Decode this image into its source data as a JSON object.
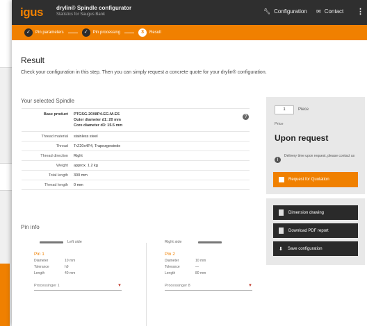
{
  "app": {
    "logo": "igus",
    "title": "drylin® Spindle configurator",
    "subtitle": "Statistics for Saugus Bank",
    "nav_config": "Configuration",
    "nav_contact": "Contact",
    "nav_more": "⋮"
  },
  "steps": [
    {
      "label": "Pin parameters",
      "state": "done"
    },
    {
      "label": "Pin processing",
      "state": "done"
    },
    {
      "label": "Result",
      "state": "current",
      "number": "3"
    }
  ],
  "result": {
    "title": "Result",
    "intro": "Check your configuration in this step. Then you can simply request a concrete quote for your drylin® configuration."
  },
  "spindle": {
    "heading": "Your selected Spindle",
    "base_label": "Base product",
    "base_lines": [
      "PTGSG-20X8P4-EG-M-ES",
      "Outer diameter d1: 20 mm",
      "Core diameter d3: 15.5 mm"
    ],
    "rows": [
      {
        "k": "Thread material",
        "v": "stainless steel"
      },
      {
        "k": "Thread",
        "v": "TrZ20x4P4, Trapezgewinde"
      },
      {
        "k": "Thread direction",
        "v": "Right"
      },
      {
        "k": "Weight",
        "v": "approx. 1.2 kg"
      },
      {
        "k": "Total length",
        "v": "300 mm"
      },
      {
        "k": "Thread length",
        "v": "0 mm"
      }
    ]
  },
  "quote": {
    "qty": "1",
    "qty_label": "Piece",
    "price_label": "Price",
    "price": "Upon request",
    "delivery": "Delivery time upon request, please contact us",
    "request_btn": "Request for Quotation"
  },
  "actions": [
    "Dimension drawing",
    "Download PDF report",
    "Save configuration"
  ],
  "pins": {
    "heading": "Pin info",
    "left": {
      "side": "Left side",
      "name": "Pin 1",
      "rows": [
        {
          "k": "Diameter",
          "v": "10 mm"
        },
        {
          "k": "Tolerance",
          "v": "h9"
        },
        {
          "k": "Length",
          "v": "40 mm"
        }
      ],
      "select": "Processinger 1"
    },
    "right": {
      "side": "Right side",
      "name": "Pin 2",
      "rows": [
        {
          "k": "Diameter",
          "v": "10 mm"
        },
        {
          "k": "Tolerance",
          "v": "—"
        },
        {
          "k": "Length",
          "v": "80 mm"
        }
      ],
      "select": "Processinger 8"
    }
  },
  "colors": {
    "accent": "#f08000",
    "topbar": "#2f2f2f",
    "action_btn": "#2a2a2a"
  }
}
